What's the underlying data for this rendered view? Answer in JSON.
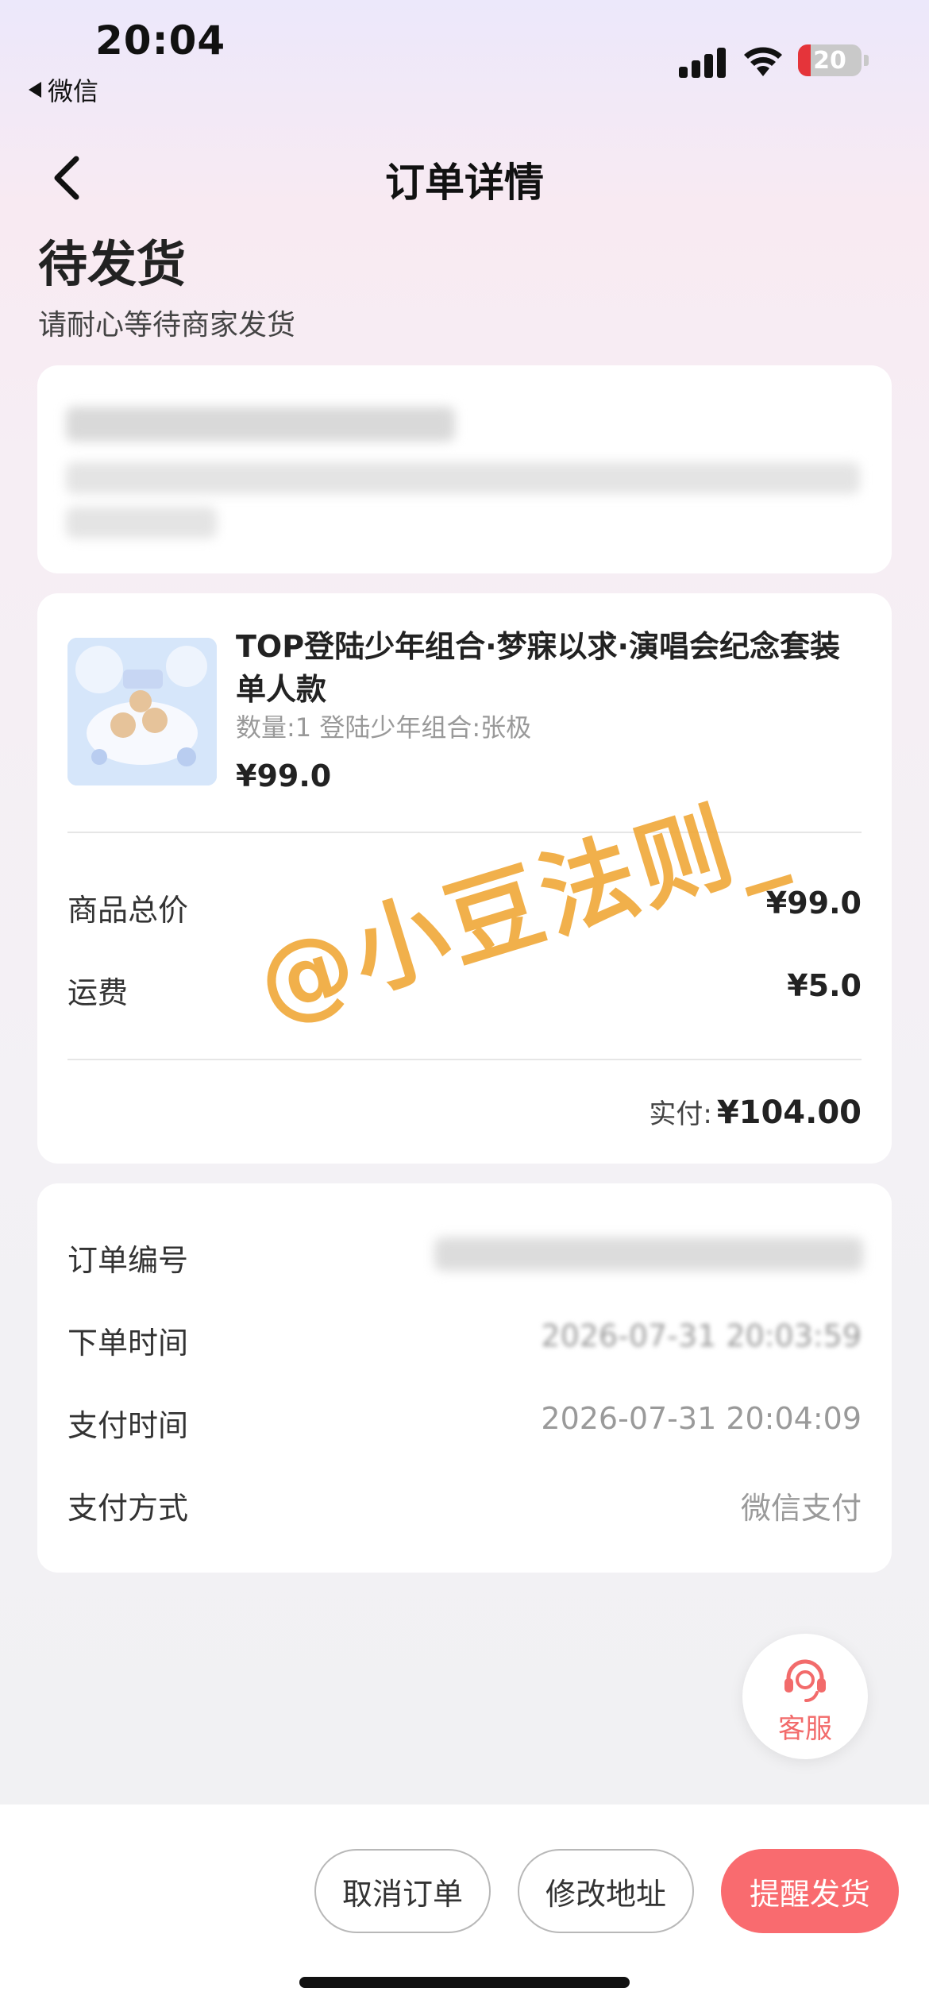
{
  "status_bar": {
    "time": "20:04",
    "back_app": "微信",
    "battery": "20"
  },
  "nav": {
    "title": "订单详情"
  },
  "order_status": {
    "title": "待发货",
    "subtitle": "请耐心等待商家发货"
  },
  "goods": {
    "name": "TOP登陆少年组合·梦寐以求·演唱会纪念套装单人款",
    "spec": "数量:1 登陆少年组合:张极",
    "price": "¥99.0"
  },
  "summary": {
    "total_label": "商品总价",
    "total_value": "¥99.0",
    "shipping_label": "运费",
    "shipping_value": "¥5.0",
    "paid_label": "实付:",
    "paid_value": "¥104.00"
  },
  "watermark": "@小豆法则_",
  "order_info": {
    "number_label": "订单编号",
    "order_time_label": "下单时间",
    "order_time_value": "2026-07-31 20:03:59",
    "pay_time_label": "支付时间",
    "pay_time_value": "2026-07-31 20:04:09",
    "pay_method_label": "支付方式",
    "pay_method_value": "微信支付"
  },
  "service": {
    "label": "客服"
  },
  "actions": {
    "cancel": "取消订单",
    "modify_address": "修改地址",
    "remind": "提醒发货"
  },
  "colors": {
    "primary": "#f96b6f",
    "watermark": "#f0aa3c",
    "service": "#f26b6b"
  }
}
